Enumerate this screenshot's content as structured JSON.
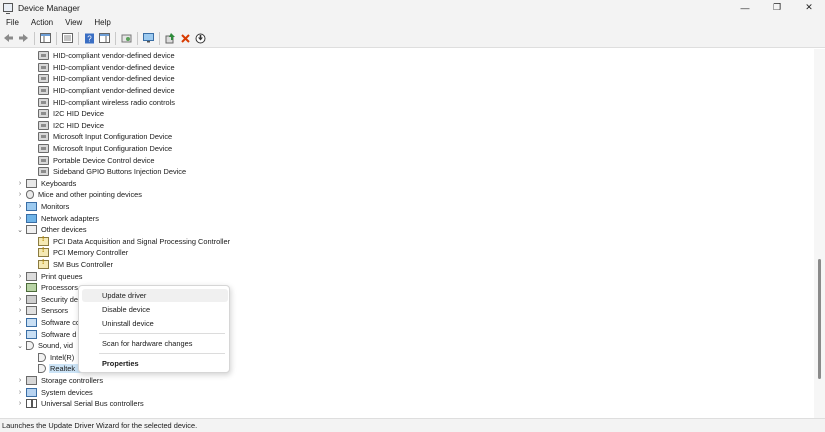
{
  "window": {
    "title": "Device Manager",
    "minimize": "—",
    "maximize": "❐",
    "close": "✕"
  },
  "menu": [
    "File",
    "Action",
    "View",
    "Help"
  ],
  "toolbar": {
    "buttons": [
      "back-icon",
      "forward-icon",
      "show-hide-console-tree-icon",
      "properties-icon",
      "help-icon",
      "action-pane-icon",
      "scan-hardware-icon",
      "monitor-icon",
      "update-driver-icon",
      "uninstall-icon",
      "download-icon"
    ],
    "accent": "#d83b01"
  },
  "tree": {
    "hid_children": [
      "HID-compliant vendor-defined device",
      "HID-compliant vendor-defined device",
      "HID-compliant vendor-defined device",
      "HID-compliant vendor-defined device",
      "HID-compliant wireless radio controls",
      "I2C HID Device",
      "I2C HID Device",
      "Microsoft Input Configuration Device",
      "Microsoft Input Configuration Device",
      "Portable Device Control device",
      "Sideband GPIO Buttons Injection Device"
    ],
    "categories": {
      "keyboards": "Keyboards",
      "mice": "Mice and other pointing devices",
      "monitors": "Monitors",
      "network": "Network adapters",
      "other": "Other devices",
      "print": "Print queues",
      "processors": "Processors",
      "security": "Security de",
      "sensors": "Sensors",
      "software_comp": "Software co",
      "software_dev": "Software d",
      "sound": "Sound, vid",
      "storage": "Storage controllers",
      "system": "System devices",
      "usb": "Universal Serial Bus controllers"
    },
    "other_children": [
      "PCI Data Acquisition and Signal Processing Controller",
      "PCI Memory Controller",
      "SM Bus Controller"
    ],
    "sound_children": [
      "Intel(R)",
      "Realtek"
    ],
    "selected": "Realtek"
  },
  "context_menu": {
    "update": "Update driver",
    "disable": "Disable device",
    "uninstall": "Uninstall device",
    "scan": "Scan for hardware changes",
    "properties": "Properties"
  },
  "status": "Launches the Update Driver Wizard for the selected device."
}
